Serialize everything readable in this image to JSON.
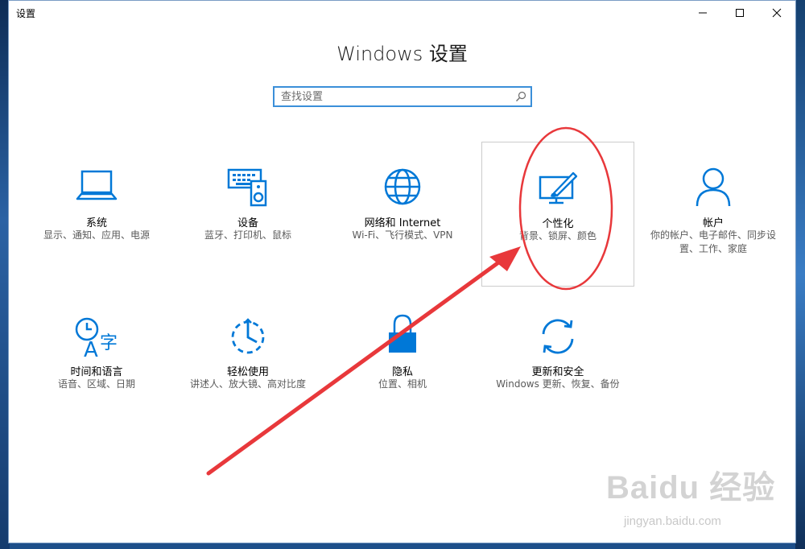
{
  "app_title": "设置",
  "heading": "Windows 设置",
  "search": {
    "placeholder": "查找设置"
  },
  "tiles": [
    {
      "label": "系统",
      "desc": "显示、通知、应用、电源"
    },
    {
      "label": "设备",
      "desc": "蓝牙、打印机、鼠标"
    },
    {
      "label": "网络和 Internet",
      "desc": "Wi-Fi、飞行模式、VPN"
    },
    {
      "label": "个性化",
      "desc": "背景、锁屏、颜色"
    },
    {
      "label": "帐户",
      "desc": "你的帐户、电子邮件、同步设置、工作、家庭"
    },
    {
      "label": "时间和语言",
      "desc": "语音、区域、日期"
    },
    {
      "label": "轻松使用",
      "desc": "讲述人、放大镜、高对比度"
    },
    {
      "label": "隐私",
      "desc": "位置、相机"
    },
    {
      "label": "更新和安全",
      "desc": "Windows 更新、恢复、备份"
    }
  ],
  "watermark": {
    "url": "jingyan.baidu.com"
  },
  "colors": {
    "accent": "#0078d7",
    "annotation": "#e8383b"
  }
}
